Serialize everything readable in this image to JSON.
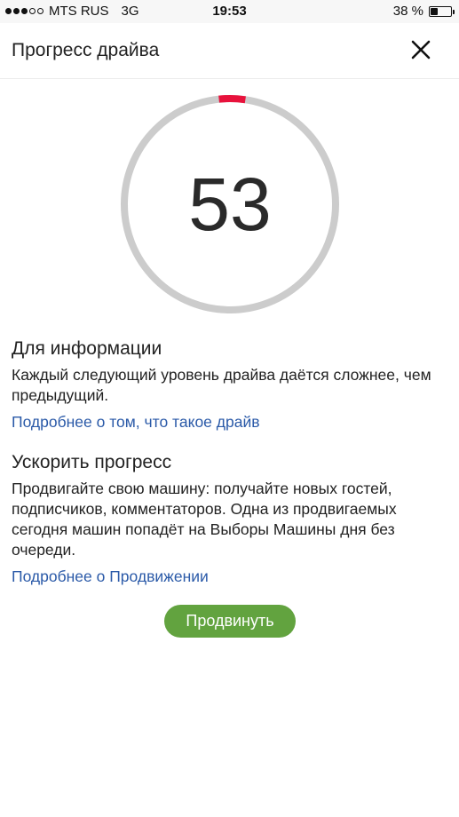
{
  "status_bar": {
    "carrier": "MTS RUS",
    "network": "3G",
    "time": "19:53",
    "battery_percent": "38 %",
    "battery_level": 0.38,
    "signal_bars": 3,
    "signal_max": 5
  },
  "header": {
    "title": "Прогресс драйва",
    "close_icon": "close-icon"
  },
  "progress": {
    "value": "53",
    "fraction": 0.04,
    "track_color": "#cccccc",
    "fill_color": "#e8123c"
  },
  "info": {
    "heading": "Для информации",
    "text": "Каждый следующий уровень драйва даётся сложнее, чем предыдущий.",
    "link": "Подробнее о том, что такое драйв"
  },
  "boost": {
    "heading": "Ускорить прогресс",
    "text": "Продвигайте свою машину: получайте новых гостей, подписчиков, комментаторов. Одна из продвигаемых сегодня машин попадёт на Выборы Машины дня без очереди.",
    "link": "Подробнее о Продвижении"
  },
  "promote_button": {
    "label": "Продвинуть",
    "color": "#62a33f"
  },
  "link_color": "#2b5aa8"
}
